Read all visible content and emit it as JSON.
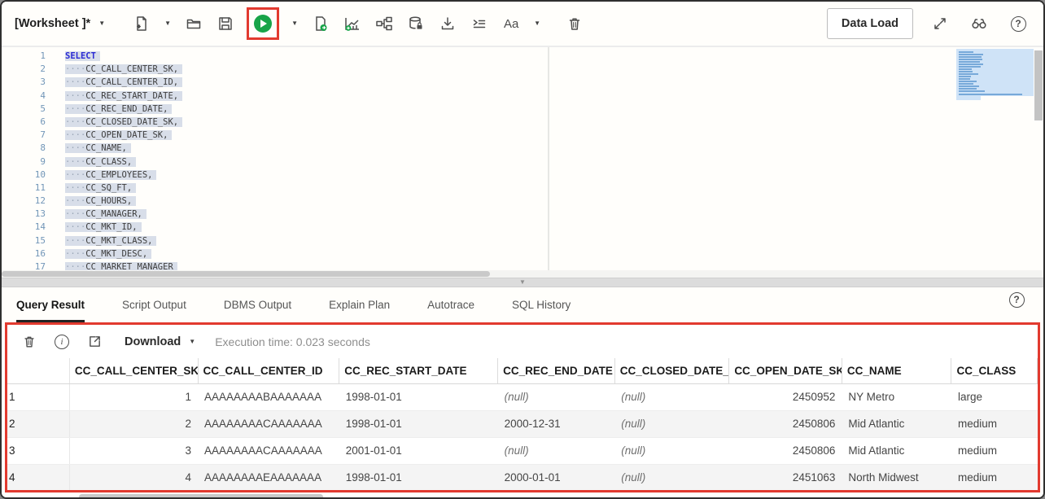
{
  "colors": {
    "accent_green": "#18a449",
    "annotation_red": "#e23a2f",
    "selection": "#d8dee9",
    "minimap_blue": "#cfe3f7"
  },
  "toolbar": {
    "worksheet_label": "[Worksheet ]*",
    "text_case_label": "Aa",
    "data_load_label": "Data Load",
    "icon_names": [
      "new-worksheet",
      "open-file",
      "save",
      "run-statement",
      "run-script",
      "explain-plan",
      "autotrace",
      "database-actions",
      "download-script",
      "format",
      "text-case",
      "clear",
      "expand",
      "find",
      "help"
    ]
  },
  "editor": {
    "lines": [
      {
        "n": "1",
        "text": "SELECT"
      },
      {
        "n": "2",
        "text": "CC_CALL_CENTER_SK,"
      },
      {
        "n": "3",
        "text": "CC_CALL_CENTER_ID,"
      },
      {
        "n": "4",
        "text": "CC_REC_START_DATE,"
      },
      {
        "n": "5",
        "text": "CC_REC_END_DATE,"
      },
      {
        "n": "6",
        "text": "CC_CLOSED_DATE_SK,"
      },
      {
        "n": "7",
        "text": "CC_OPEN_DATE_SK,"
      },
      {
        "n": "8",
        "text": "CC_NAME,"
      },
      {
        "n": "9",
        "text": "CC_CLASS,"
      },
      {
        "n": "10",
        "text": "CC_EMPLOYEES,"
      },
      {
        "n": "11",
        "text": "CC_SQ_FT,"
      },
      {
        "n": "12",
        "text": "CC_HOURS,"
      },
      {
        "n": "13",
        "text": "CC_MANAGER,"
      },
      {
        "n": "14",
        "text": "CC_MKT_ID,"
      },
      {
        "n": "15",
        "text": "CC_MKT_CLASS,"
      },
      {
        "n": "16",
        "text": "CC_MKT_DESC,"
      },
      {
        "n": "17",
        "text": "CC_MARKET_MANAGER"
      }
    ]
  },
  "tabs": [
    {
      "label": "Query Result"
    },
    {
      "label": "Script Output"
    },
    {
      "label": "DBMS Output"
    },
    {
      "label": "Explain Plan"
    },
    {
      "label": "Autotrace"
    },
    {
      "label": "SQL History"
    }
  ],
  "result": {
    "download_label": "Download",
    "execution_time": "Execution time: 0.023 seconds",
    "table": {
      "columns": [
        "",
        "CC_CALL_CENTER_SK",
        "CC_CALL_CENTER_ID",
        "CC_REC_START_DATE",
        "CC_REC_END_DATE",
        "CC_CLOSED_DATE_SI",
        "CC_OPEN_DATE_SK",
        "CC_NAME",
        "CC_CLASS"
      ],
      "rows": [
        [
          "1",
          "1",
          "AAAAAAAABAAAAAAA",
          "1998-01-01",
          "(null)",
          "(null)",
          "2450952",
          "NY Metro",
          "large"
        ],
        [
          "2",
          "2",
          "AAAAAAAACAAAAAAA",
          "1998-01-01",
          "2000-12-31",
          "(null)",
          "2450806",
          "Mid Atlantic",
          "medium"
        ],
        [
          "3",
          "3",
          "AAAAAAAACAAAAAAA",
          "2001-01-01",
          "(null)",
          "(null)",
          "2450806",
          "Mid Atlantic",
          "medium"
        ],
        [
          "4",
          "4",
          "AAAAAAAAEAAAAAAA",
          "1998-01-01",
          "2000-01-01",
          "(null)",
          "2451063",
          "North Midwest",
          "medium"
        ]
      ]
    }
  }
}
